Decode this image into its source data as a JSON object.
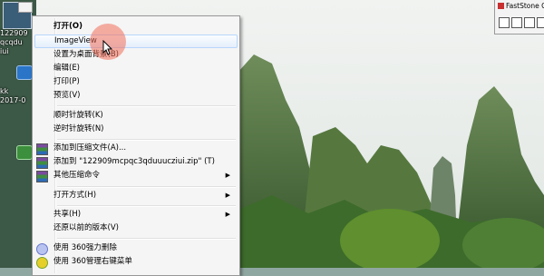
{
  "desktop": {
    "icon1": {
      "lines": [
        "122909",
        "qcqdu",
        "iui"
      ]
    },
    "icon2": {
      "lines": [
        "kk",
        "2017-0"
      ]
    }
  },
  "faststone": {
    "title": "FastStone C",
    "buttons": [
      "capture-window-icon",
      "capture-object-icon",
      "capture-rect-icon",
      "capture-full-icon"
    ]
  },
  "menu": {
    "items": [
      {
        "label": "打开(O)",
        "bold": true
      },
      {
        "label": "ImageView",
        "highlight": true
      },
      {
        "label": "设置为桌面背景(B)"
      },
      {
        "label": "编辑(E)"
      },
      {
        "label": "打印(P)"
      },
      {
        "label": "预览(V)"
      },
      {
        "label": "顺时针旋转(K)"
      },
      {
        "label": "逆时针旋转(N)"
      },
      {
        "label": "添加到压缩文件(A)...",
        "icon": "winrar-icon"
      },
      {
        "label": "添加到 \"122909mcpqc3qduuucziui.zip\" (T)",
        "icon": "winrar-icon"
      },
      {
        "label": "其他压缩命令",
        "icon": "winrar-icon",
        "submenu": true
      },
      {
        "label": "打开方式(H)",
        "submenu": true
      },
      {
        "label": "共享(H)",
        "submenu": true
      },
      {
        "label": "还原以前的版本(V)"
      },
      {
        "label": "使用 360强力删除",
        "icon": "360-delete-icon"
      },
      {
        "label": "使用 360管理右键菜单",
        "icon": "360-manage-icon"
      }
    ],
    "submenu_arrow": "▶"
  }
}
